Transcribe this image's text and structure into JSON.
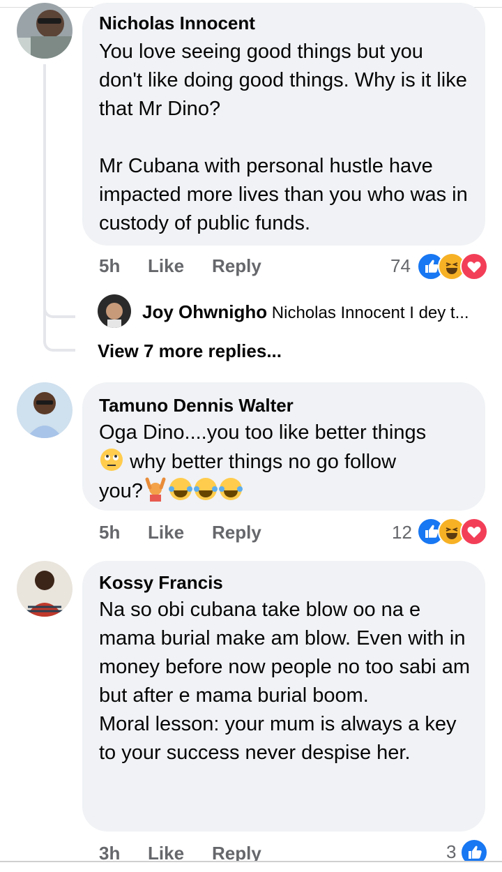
{
  "comments": [
    {
      "author": "Nicholas Innocent",
      "text": "You love seeing good things but you don't like doing good things. Why is it like that Mr Dino?\n\nMr Cubana with personal hustle have impacted more lives than you who was in custody of public funds.",
      "time": "5h",
      "like_label": "Like",
      "reply_label": "Reply",
      "reaction_count": "74",
      "reactions": [
        "like-icon",
        "haha-icon",
        "love-icon"
      ]
    },
    {
      "author": "Tamuno Dennis Walter",
      "text_line1": "Oga Dino....you too like better things",
      "text_line2": "why better things no go follow",
      "text_line3": "you?",
      "time": "5h",
      "like_label": "Like",
      "reply_label": "Reply",
      "reaction_count": "12",
      "reactions": [
        "like-icon",
        "haha-icon",
        "love-icon"
      ]
    },
    {
      "author": "Kossy Francis",
      "text": "Na so obi cubana take blow oo na e mama burial make am blow. Even with in money before now people no too sabi am but after e mama burial boom.\nMoral lesson: your mum is always a key to your success never despise her.",
      "time": "3h",
      "like_label": "Like",
      "reply_label": "Reply",
      "reaction_count": "3",
      "reactions": [
        "like-icon"
      ]
    }
  ],
  "reply_preview": {
    "author": "Joy Ohwnigho",
    "text": "Nicholas Innocent I dey t..."
  },
  "view_more": "View 7 more replies...",
  "colors": {
    "bubble": "#f0f2f5",
    "meta": "#65676b",
    "like_blue": "#1877f2",
    "love_red": "#f33e58",
    "haha_yellow": "#f7b125"
  }
}
